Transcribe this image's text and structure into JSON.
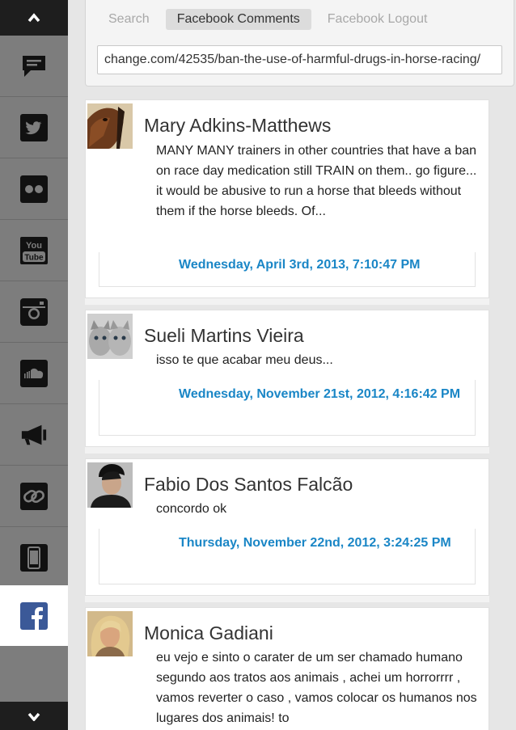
{
  "sidebar": {
    "items": [
      {
        "icon": "comment-icon"
      },
      {
        "icon": "twitter-icon"
      },
      {
        "icon": "flickr-icon"
      },
      {
        "icon": "youtube-icon",
        "label_top": "You",
        "label_bottom": "Tube"
      },
      {
        "icon": "instagram-icon"
      },
      {
        "icon": "soundcloud-icon"
      },
      {
        "icon": "megaphone-icon"
      },
      {
        "icon": "link-icon"
      },
      {
        "icon": "mobile-icon"
      },
      {
        "icon": "facebook-icon",
        "active": true
      }
    ]
  },
  "tabs": [
    {
      "label": "Search"
    },
    {
      "label": "Facebook Comments"
    },
    {
      "label": "Facebook Logout"
    }
  ],
  "url_value": "change.com/42535/ban-the-use-of-harmful-drugs-in-horse-racing/",
  "comments": [
    {
      "name": "Mary Adkins-Matthews",
      "text": "MANY MANY trainers in other countries that have a ban on race day medication still TRAIN on them.. go figure... it would be abusive to run a horse that bleeds without them if the horse bleeds. Of...",
      "date": "Wednesday, April 3rd, 2013, 7:10:47 PM"
    },
    {
      "name": "Sueli Martins Vieira",
      "text": "isso te que acabar meu deus...",
      "date": "Wednesday, November 21st, 2012, 4:16:42 PM"
    },
    {
      "name": "Fabio Dos Santos Falcão",
      "text": "concordo ok",
      "date": "Thursday, November 22nd, 2012, 3:24:25 PM"
    },
    {
      "name": "Monica Gadiani",
      "text": "eu vejo e sinto o carater de um ser chamado humano segundo aos tratos aos animais , achei um horrorrrr , vamos reverter o caso , vamos colocar os humanos nos lugares dos animais! to",
      "date": ""
    }
  ],
  "colors": {
    "sidebar_bg": "#7d7d7d",
    "sidebar_dark": "#1e1e1e",
    "date_link": "#1a86c6",
    "facebook_blue": "#3b5998"
  }
}
